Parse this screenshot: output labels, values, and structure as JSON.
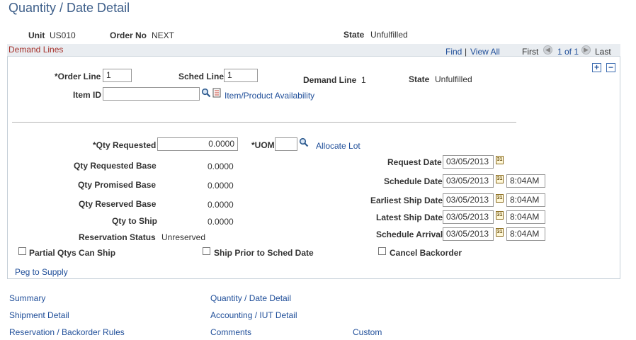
{
  "page_title": "Quantity / Date Detail",
  "header": {
    "unit_label": "Unit",
    "unit_value": "US010",
    "order_label": "Order No",
    "order_value": "NEXT",
    "state_label": "State",
    "state_value": "Unfulfilled"
  },
  "grid": {
    "title": "Demand Lines",
    "find": "Find",
    "sep": "|",
    "view_all": "View All",
    "first": "First",
    "page_info": "1 of 1",
    "last": "Last"
  },
  "line": {
    "order_line_label": "*Order Line",
    "order_line_value": "1",
    "sched_line_label": "Sched Line",
    "sched_line_value": "1",
    "demand_line_label": "Demand Line",
    "demand_line_value": "1",
    "state_label": "State",
    "state_value": "Unfulfilled",
    "item_id_label": "Item ID",
    "item_id_value": "",
    "item_avail_link": "Item/Product Availability"
  },
  "qty": {
    "requested_label": "*Qty Requested",
    "requested_value": "0.0000",
    "uom_label": "*UOM",
    "uom_value": "",
    "allocate_lot": "Allocate Lot",
    "requested_base_label": "Qty Requested Base",
    "requested_base_value": "0.0000",
    "promised_base_label": "Qty Promised Base",
    "promised_base_value": "0.0000",
    "reserved_base_label": "Qty Reserved Base",
    "reserved_base_value": "0.0000",
    "to_ship_label": "Qty to Ship",
    "to_ship_value": "0.0000",
    "res_status_label": "Reservation Status",
    "res_status_value": "Unreserved"
  },
  "dates": {
    "request_label": "Request Date",
    "request_date": "03/05/2013",
    "schedule_label": "Schedule Date",
    "schedule_date": "03/05/2013",
    "schedule_time": "8:04AM",
    "earliest_label": "Earliest Ship Date",
    "earliest_date": "03/05/2013",
    "earliest_time": "8:04AM",
    "latest_label": "Latest Ship Date",
    "latest_date": "03/05/2013",
    "latest_time": "8:04AM",
    "arrival_label": "Schedule Arrival",
    "arrival_date": "03/05/2013",
    "arrival_time": "8:04AM",
    "calendar_glyph": "31"
  },
  "checkboxes": {
    "partial": "Partial Qtys Can Ship",
    "ship_prior": "Ship Prior to Sched Date",
    "cancel_backorder": "Cancel Backorder"
  },
  "peg_link": "Peg to Supply",
  "footer_links": {
    "summary": "Summary",
    "qty_date": "Quantity / Date Detail",
    "shipment": "Shipment Detail",
    "accounting": "Accounting / IUT Detail",
    "reservation": "Reservation / Backorder Rules",
    "comments": "Comments",
    "custom": "Custom"
  }
}
